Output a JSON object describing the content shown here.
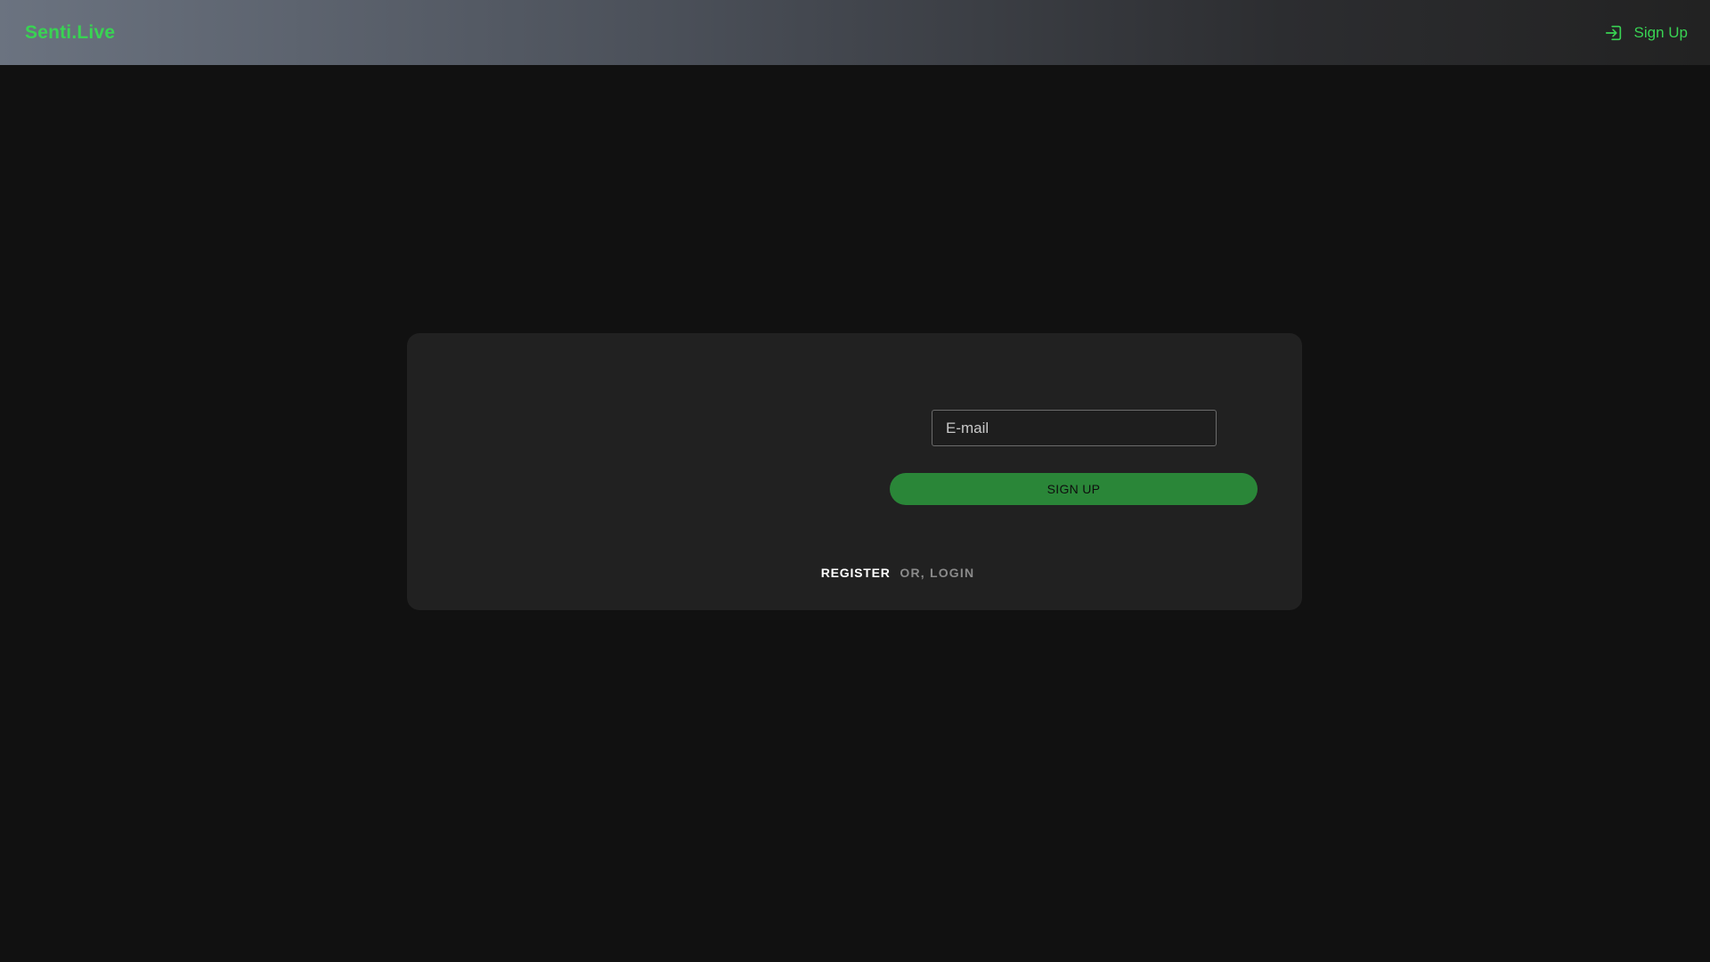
{
  "header": {
    "brand": "Senti.Live",
    "signup_label": "Sign Up",
    "signup_icon": "sign-in-icon",
    "accent_color": "#39d353"
  },
  "form": {
    "email_placeholder": "E-mail",
    "email_value": "",
    "submit_label": "SIGN UP",
    "button_color": "#2a8638"
  },
  "footer": {
    "register_label": "REGISTER",
    "login_label": "OR, LOGIN"
  }
}
